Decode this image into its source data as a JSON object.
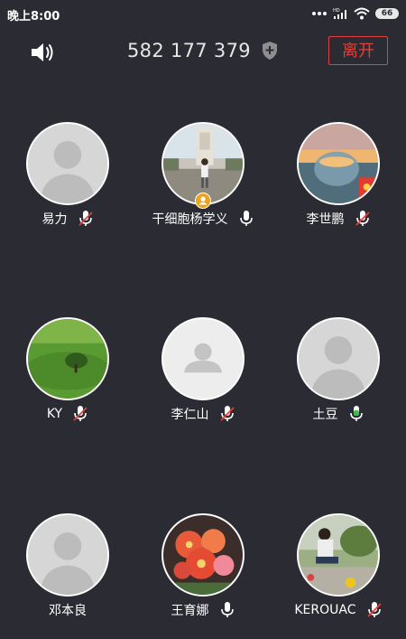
{
  "status_bar": {
    "time": "晚上8:00",
    "battery": "66",
    "icons": [
      "more-dots-icon",
      "hd-signal-icon",
      "wifi-icon",
      "battery-icon"
    ]
  },
  "header": {
    "speaker_icon": "speaker-icon",
    "room_id": "582 177 379",
    "shield_icon": "shield-plus-icon",
    "leave_label": "离开",
    "leave_color": "#e2403a"
  },
  "participants": [
    {
      "name": "易力",
      "mic": "muted",
      "avatar": "default"
    },
    {
      "name": "干细胞杨学义",
      "mic": "on",
      "avatar": "photo-monument",
      "host": true
    },
    {
      "name": "李世鹏",
      "mic": "muted",
      "avatar": "photo-sunset-glass"
    },
    {
      "name": "KY",
      "mic": "muted",
      "avatar": "photo-green-tree"
    },
    {
      "name": "李仁山",
      "mic": "muted",
      "avatar": "default-light"
    },
    {
      "name": "土豆",
      "mic": "speaking",
      "avatar": "default"
    },
    {
      "name": "邓本良",
      "mic": "none",
      "avatar": "default"
    },
    {
      "name": "王育娜",
      "mic": "on",
      "avatar": "photo-flowers"
    },
    {
      "name": "KEROUAC",
      "mic": "muted",
      "avatar": "photo-garden"
    }
  ],
  "colors": {
    "background": "#2b2b33",
    "muted_slash": "#e2403a",
    "speaking": "#3fbf4a"
  }
}
